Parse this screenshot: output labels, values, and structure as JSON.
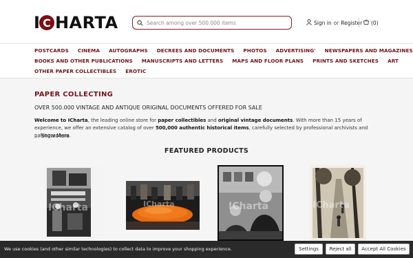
{
  "header": {
    "logo_letter_i": "I",
    "logo_letter_c": "C",
    "logo_rest": "HARTA",
    "search_placeholder": "Search among over 500.000 items",
    "sign_in": "Sign in",
    "or_text": "or",
    "register": "Register",
    "cart_count": "(0)"
  },
  "nav": {
    "row1": [
      "POSTCARDS",
      "CINEMA",
      "AUTOGRAPHS",
      "DECREES AND DOCUMENTS",
      "PHOTOS",
      "ADVERTISING'",
      "NEWSPAPERS AND MAGAZINES"
    ],
    "row2": [
      "BOOKS AND OTHER PUBLICATIONS",
      "MANUSCRIPTS AND LETTERS",
      "MAPS AND FLOOR PLANS",
      "PRINTS AND SKETCHES",
      "ART"
    ],
    "row3": [
      "OTHER PAPER COLLECTIBLES",
      "EROTIC"
    ]
  },
  "main": {
    "title": "PAPER COLLECTING",
    "subtitle": "OVER 500.000 VINTAGE AND ANTIQUE ORIGINAL DOCUMENTS OFFERED FOR SALE",
    "intro_parts": {
      "p1": "Welcome to ICharta",
      "p2": ", the leading online store for ",
      "p3": "paper collectibles",
      "p4": " and ",
      "p5": "original vintage documents",
      "p6": ". With more than 15 years of experience, we offer an extensive catalog of over ",
      "p7": "500,000 authentic historical items",
      "p8": ", carefully selected by professional archivists and paleographers."
    },
    "show_more": "... Show More",
    "featured_title": "FEATURED PRODUCTS",
    "watermark": "ICharta"
  },
  "cookie": {
    "text": "We use cookies (and other similar technologies) to collect data to improve your shopping experience.",
    "settings": "Settings",
    "reject": "Reject all",
    "accept": "Accept All Cookies"
  },
  "colors": {
    "brand": "#7a1218",
    "search_border": "#8a1c22",
    "cookie_bar": "#2a2a2a"
  }
}
